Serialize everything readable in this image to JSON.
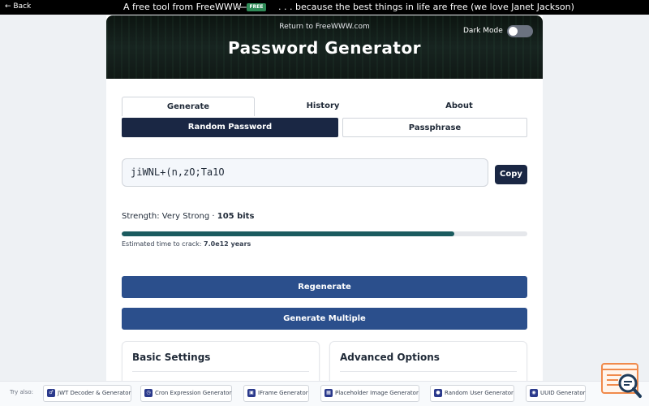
{
  "topbar": {
    "back_label": "← Back",
    "tagline_left": "A free tool from FreeWWW",
    "badge_label": "FREE",
    "tagline_right": ". . . because the best things in life are free (we love Janet Jackson)"
  },
  "hero": {
    "return_link": "Return to FreeWWW.com",
    "title": "Password Generator",
    "dark_mode_label": "Dark Mode",
    "dark_mode_on": false
  },
  "tabs": [
    {
      "label": "Generate",
      "active": true
    },
    {
      "label": "History",
      "active": false
    },
    {
      "label": "About",
      "active": false
    }
  ],
  "subtabs": [
    {
      "label": "Random Password",
      "active": true
    },
    {
      "label": "Passphrase",
      "active": false
    }
  ],
  "password": {
    "value": "jiWNL+(n,zO;Ta1O",
    "copy_label": "Copy"
  },
  "strength": {
    "prefix": "Strength: Very Strong · ",
    "bits": "105 bits",
    "fraction": 0.82,
    "crack_prefix": "Estimated time to crack: ",
    "crack_value": "7.0e12 years"
  },
  "actions": {
    "regenerate": "Regenerate",
    "generate_multiple": "Generate Multiple"
  },
  "panels": {
    "basic": "Basic Settings",
    "advanced": "Advanced Options"
  },
  "try_bar": {
    "label": "Try also:",
    "items": [
      {
        "label": "JWT Decoder & Generator",
        "icon": "key-icon"
      },
      {
        "label": "Cron Expression Generator",
        "icon": "clock-icon"
      },
      {
        "label": "IFrame Generator",
        "icon": "frame-icon"
      },
      {
        "label": "Placeholder Image Generator",
        "icon": "image-icon"
      },
      {
        "label": "Random User Generator",
        "icon": "user-icon"
      },
      {
        "label": "UUID Generator",
        "icon": "fingerprint-icon"
      }
    ]
  },
  "colors": {
    "navy": "#1a2744",
    "action_blue": "#2b4f8c",
    "strength_bar": "#1b5b5f"
  }
}
